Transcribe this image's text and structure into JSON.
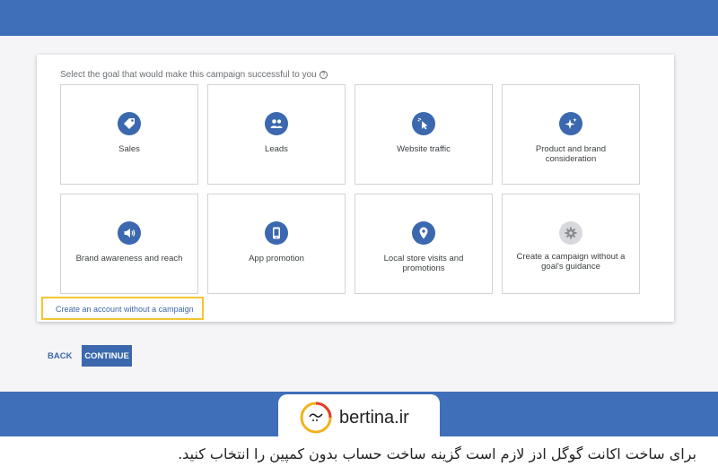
{
  "prompt": "Select the goal that would make this campaign successful to you",
  "goals": [
    {
      "label": "Sales",
      "icon": "tag-icon"
    },
    {
      "label": "Leads",
      "icon": "people-icon"
    },
    {
      "label": "Website traffic",
      "icon": "cursor-click-icon"
    },
    {
      "label": "Product and brand consideration",
      "icon": "sparkle-icon"
    },
    {
      "label": "Brand awareness and reach",
      "icon": "megaphone-icon"
    },
    {
      "label": "App promotion",
      "icon": "phone-icon"
    },
    {
      "label": "Local store visits and promotions",
      "icon": "location-pin-icon"
    },
    {
      "label": "Create a campaign without a goal's guidance",
      "icon": "gear-icon"
    }
  ],
  "no_campaign_link": "Create an account without a campaign",
  "buttons": {
    "back": "BACK",
    "continue": "CONTINUE"
  },
  "brand": "bertina.ir",
  "caption": "برای ساخت اکانت گوگل ادز لازم است گزینه ساخت حساب بدون کمپین را انتخاب کنید.",
  "colors": {
    "primary": "#3b68ae",
    "banner": "#3f6fb8",
    "highlight": "#f4c531"
  }
}
